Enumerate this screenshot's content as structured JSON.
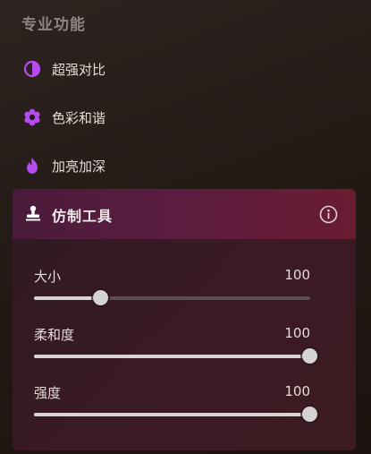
{
  "section_title": "专业功能",
  "accent_color": "#b64cf0",
  "menu": [
    {
      "label": "超强对比",
      "icon": "contrast-icon"
    },
    {
      "label": "色彩和谐",
      "icon": "flower-icon"
    },
    {
      "label": "加亮加深",
      "icon": "flame-icon"
    }
  ],
  "panel": {
    "title": "仿制工具",
    "icon": "stamp-icon",
    "info_icon": "info-icon",
    "sliders": [
      {
        "label": "大小",
        "value": "100",
        "level": 0.24
      },
      {
        "label": "柔和度",
        "value": "100",
        "level": 1.0
      },
      {
        "label": "强度",
        "value": "100",
        "level": 1.0
      }
    ]
  }
}
